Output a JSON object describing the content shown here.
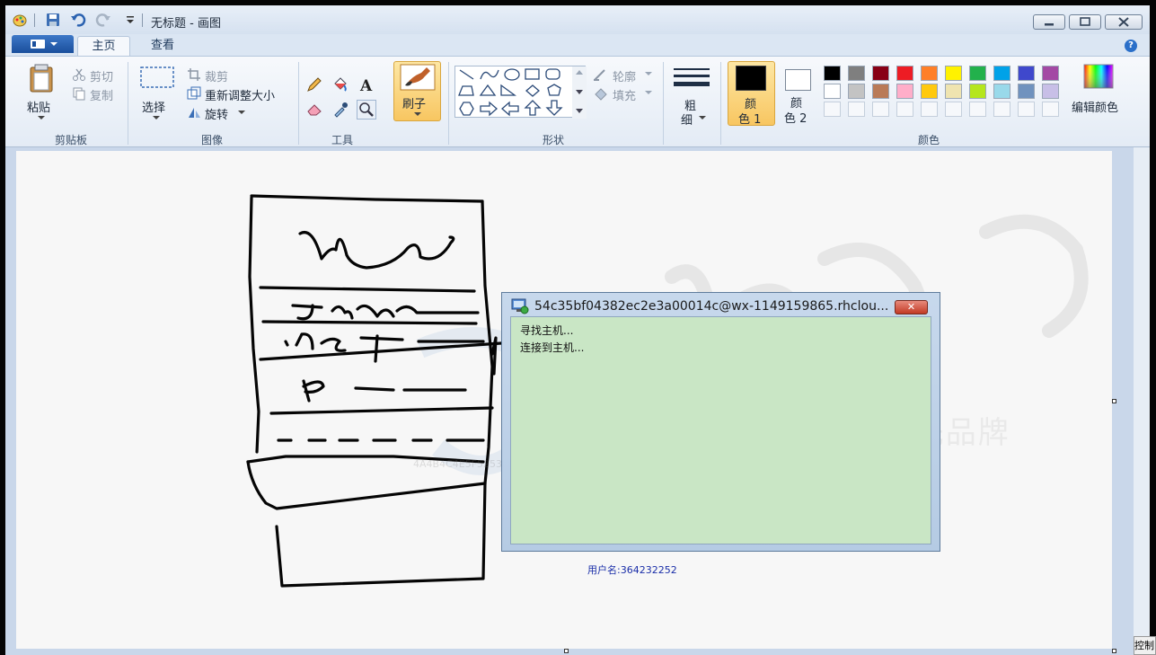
{
  "window": {
    "title": "无标题 - 画图"
  },
  "tabs": [
    {
      "label": "主页",
      "active": true
    },
    {
      "label": "查看",
      "active": false
    }
  ],
  "clipboard": {
    "paste": "粘贴",
    "cut": "剪切",
    "copy": "复制",
    "group": "剪贴板"
  },
  "image": {
    "select": "选择",
    "crop": "裁剪",
    "resize": "重新调整大小",
    "rotate": "旋转",
    "group": "图像"
  },
  "tools": {
    "group": "工具",
    "brush": "刷子"
  },
  "shapes": {
    "outline": "轮廓",
    "fill": "填充",
    "group": "形状"
  },
  "size": {
    "label_1": "粗",
    "label_2": "细"
  },
  "colors": {
    "color1_a": "颜",
    "color1_b": "色 1",
    "color2_a": "颜",
    "color2_b": "色 2",
    "edit": "编辑颜色",
    "group": "颜色",
    "palette_row1": [
      "#000000",
      "#7f7f7f",
      "#880015",
      "#ed1c24",
      "#ff7f27",
      "#fff200",
      "#22b14c",
      "#00a2e8",
      "#3f48cc",
      "#a349a4"
    ],
    "palette_row2": [
      "#ffffff",
      "#c3c3c3",
      "#b97a57",
      "#ffaec9",
      "#ffc90e",
      "#efe4b0",
      "#b5e61d",
      "#99d9ea",
      "#7092be",
      "#c8bfe7"
    ],
    "color1_value": "#000000",
    "color2_value": "#ffffff"
  },
  "dialog": {
    "title": "54c35bf04382ec2e3a00014c@wx-1149159865.rhclou...",
    "line1": "寻找主机...",
    "line2": "连接到主机..."
  },
  "overlay": {
    "user": "用户名:364232252",
    "watermark": "IT互联网教育领先品牌",
    "corner": "控制"
  }
}
